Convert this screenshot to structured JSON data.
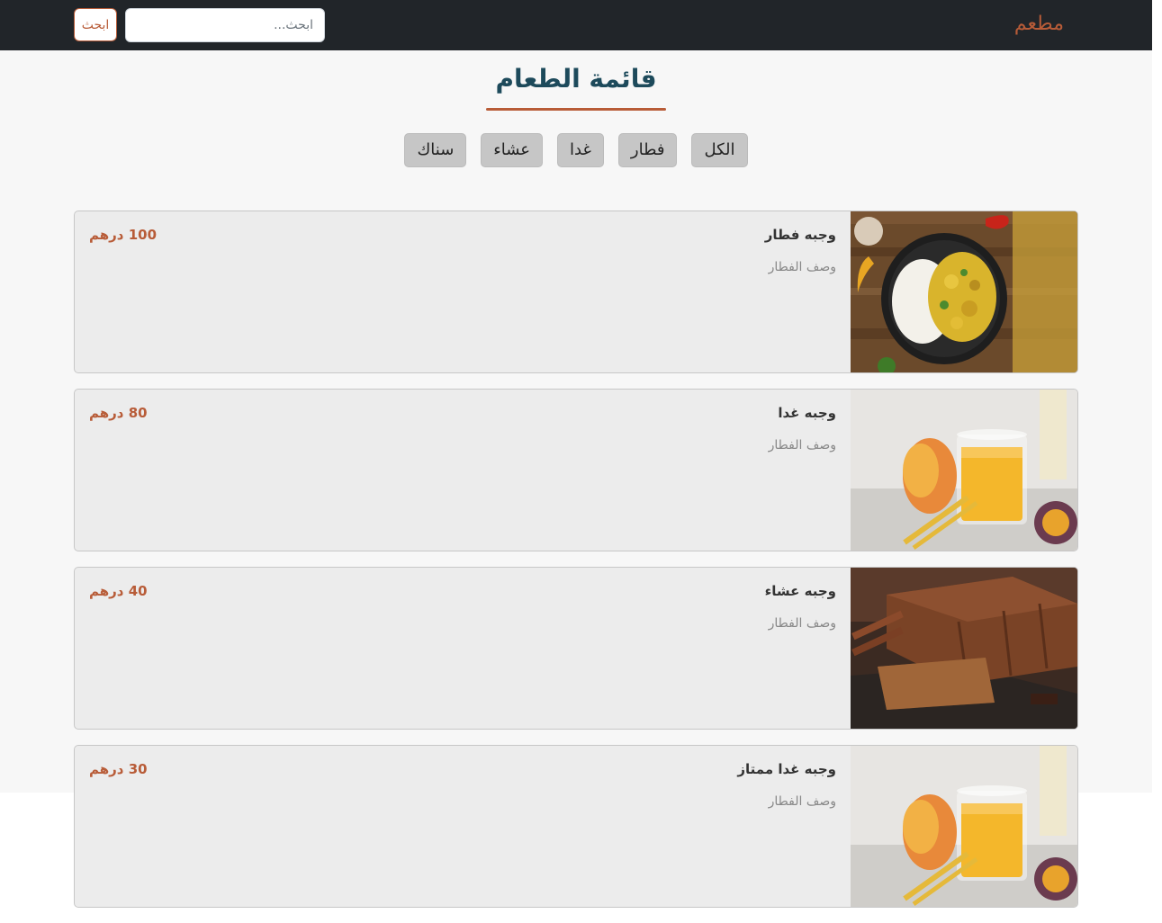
{
  "navbar": {
    "brand": "مطعم",
    "search_placeholder": "ابحث...",
    "search_button": "ابحث"
  },
  "page": {
    "title": "قائمة الطعام"
  },
  "filters": [
    "الكل",
    "فطار",
    "غدا",
    "عشاء",
    "سناك"
  ],
  "menu_items": [
    {
      "name": "وجبه فطار",
      "description": "وصف الفطار",
      "price": "100 درهم",
      "image": "curry-rice-dish"
    },
    {
      "name": "وجبه غدا",
      "description": "وصف الفطار",
      "price": "80 درهم",
      "image": "mango-juice-glass"
    },
    {
      "name": "وجبه عشاء",
      "description": "وصف الفطار",
      "price": "40 درهم",
      "image": "chocolate-loaf-cake"
    },
    {
      "name": "وجبه غدا ممتاز",
      "description": "وصف الفطار",
      "price": "30 درهم",
      "image": "mango-juice-glass"
    }
  ],
  "colors": {
    "accent": "#b85c38",
    "title": "#1d4a5b",
    "navbar": "#212529"
  }
}
